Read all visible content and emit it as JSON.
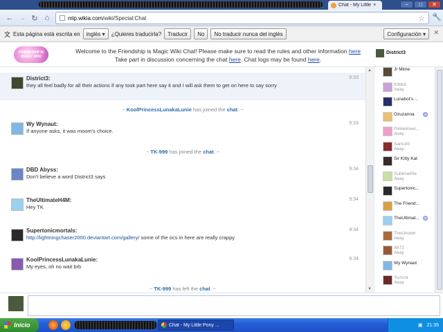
{
  "browser": {
    "tab_title": "Chat - My Little",
    "url_host": "mlp.wikia.com",
    "url_path": "/wiki/Special:Chat"
  },
  "translate_bar": {
    "prompt": "Esta página está escrita en",
    "language": "inglés",
    "question": "¿Quieres traducirla?",
    "translate_btn": "Traducir",
    "no_btn": "No",
    "never_btn": "No traducir nunca del inglés",
    "config_btn": "Configuración"
  },
  "header": {
    "logo_text": "FRIENDSHIP IS MAGIC WIKI",
    "motd_line1": "Welcome to the Friendship is Magic Wiki Chat! Please make sure to read the rules and other information",
    "motd_line1_link": "here",
    "motd_line2_a": "Take part in discussion concerning the chat",
    "motd_line2_link1": "here",
    "motd_line2_b": ". Chat logs may be found",
    "motd_line2_link2": "here"
  },
  "current_user": "District3",
  "messages": [
    {
      "user": "District3:",
      "text": "they all feel badly for all their actions if any took part here say it and I will ask them to get on here to say sorry",
      "time": "9:33",
      "avatar_color": "#3c4a2e"
    },
    {
      "alert_pre": "~ ",
      "alert_user": "KoolPrincessLunakaLunie",
      "alert_mid": " has joined the ",
      "alert_chat": "chat",
      "alert_post": ". ~"
    },
    {
      "user": "Wy Wynaut:",
      "text": "If anyone asks, it was moom's choice.",
      "time": "9:33",
      "avatar_color": "#7fb8e6"
    },
    {
      "alert_pre": "~ ",
      "alert_user": "TK-999",
      "alert_mid": " has joined the ",
      "alert_chat": "chat",
      "alert_post": ". ~"
    },
    {
      "user": "DBD Abyss:",
      "text": "Don't believe a word District3 says",
      "time": "9:34",
      "avatar_color": "#6a86c8"
    },
    {
      "user": "TheUltimateH4M:",
      "text": "Hey TK",
      "time": "9:34",
      "avatar_color": "#9ad0f0"
    },
    {
      "user": "Supertonicmortals:",
      "link": "http://lightningchaser2000.deviantart.com/gallery/",
      "text": " some of the ocs in here are really crappy",
      "time": "9:34",
      "avatar_color": "#2a2a2a"
    },
    {
      "user": "KoolPrincessLunakaLunie:",
      "text": "My eyes, oh no wait brb",
      "time": "9:34",
      "avatar_color": "#8a5ab0"
    },
    {
      "alert_pre": "~ ",
      "alert_user": "TK-999",
      "alert_mid": " has left the ",
      "alert_chat": "chat",
      "alert_post": ". ~"
    }
  ],
  "users": [
    {
      "name": "Jr Mime",
      "status": "",
      "away": false,
      "color": "#5a4a3a"
    },
    {
      "name": "Kittilot",
      "status": "Away",
      "away": true,
      "color": "#c9a0d8"
    },
    {
      "name": "Lunabot's ...",
      "status": "",
      "away": false,
      "color": "#2a2f6a"
    },
    {
      "name": "Ozuzanna",
      "status": "",
      "away": false,
      "color": "#e8c070",
      "icon": true
    },
    {
      "name": "Pinkielover...",
      "status": "Away",
      "away": true,
      "color": "#f0a0c8"
    },
    {
      "name": "SamuIS",
      "status": "Away",
      "away": true,
      "color": "#8a2a2a"
    },
    {
      "name": "Sir Kitty Kat",
      "status": "",
      "away": false,
      "color": "#3a2a2a"
    },
    {
      "name": "SublimePie",
      "status": "Away",
      "away": true,
      "color": "#c8e0a0"
    },
    {
      "name": "Supertonic...",
      "status": "",
      "away": false,
      "color": "#2a2a2a"
    },
    {
      "name": "The Friend...",
      "status": "",
      "away": false,
      "color": "#d8a04a"
    },
    {
      "name": "TheUltimat...",
      "status": "",
      "away": false,
      "color": "#9ad0f0",
      "icon": true
    },
    {
      "name": "TheUnown",
      "status": "Away",
      "away": true,
      "color": "#a86a3a"
    },
    {
      "name": "Wi72",
      "status": "Away",
      "away": true,
      "color": "#9a5a3a"
    },
    {
      "name": "Wy Wynaut",
      "status": "",
      "away": false,
      "color": "#7fb8e6"
    },
    {
      "name": "Yuzura",
      "status": "Away",
      "away": true,
      "color": "#6a2a2a"
    }
  ],
  "taskbar": {
    "start": "Inicio",
    "item": "Chat - My Little Pony ...",
    "clock": "21:35"
  },
  "colors": {
    "accent": "#2b6cb0",
    "link": "#1a4fa0",
    "shade": "#eef3f9"
  }
}
